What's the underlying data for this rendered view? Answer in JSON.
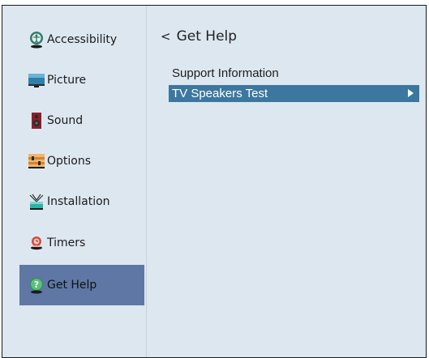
{
  "sidebar": {
    "items": [
      {
        "label": "Accessibility",
        "icon": "accessibility-icon"
      },
      {
        "label": "Picture",
        "icon": "picture-icon"
      },
      {
        "label": "Sound",
        "icon": "speaker-icon"
      },
      {
        "label": "Options",
        "icon": "options-icon"
      },
      {
        "label": "Installation",
        "icon": "antenna-icon"
      },
      {
        "label": "Timers",
        "icon": "timer-icon"
      },
      {
        "label": "Get Help",
        "icon": "help-icon",
        "selected": true
      }
    ]
  },
  "main": {
    "back_glyph": "<",
    "title": "Get Help",
    "options": [
      {
        "label": "Support Information"
      },
      {
        "label": "TV Speakers Test",
        "selected": true
      }
    ]
  },
  "colors": {
    "background": "#dde7f0",
    "sidebar_selected": "#5f77a4",
    "option_selected": "#3c779f"
  }
}
